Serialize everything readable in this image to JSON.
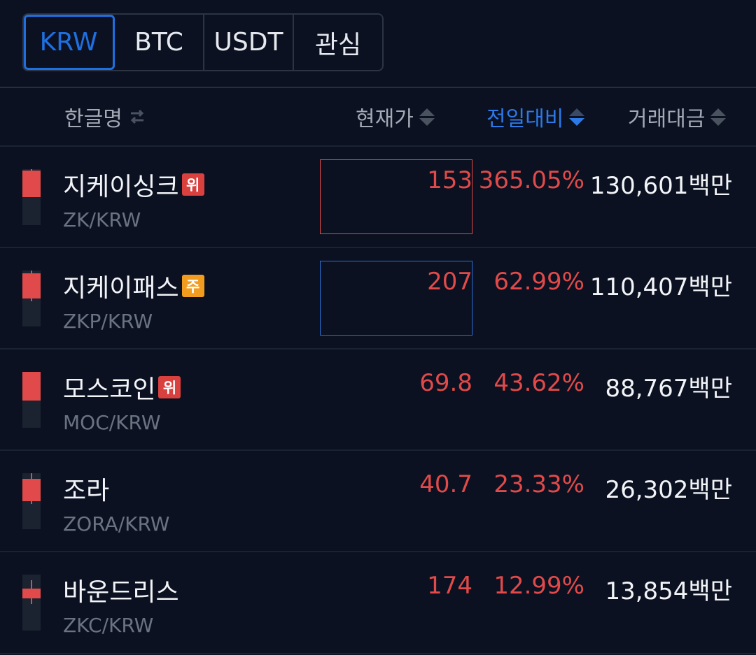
{
  "tabs": [
    "KRW",
    "BTC",
    "USDT",
    "관심"
  ],
  "header": {
    "name": "한글명",
    "price": "현재가",
    "change": "전일대비",
    "volume": "거래대금"
  },
  "colors": {
    "up": "#e04a4a",
    "accent": "#1f6fe0",
    "warning_badge": "#d9413f",
    "caution_badge": "#f29c1f",
    "flash_up": "#e04a4a",
    "flash_neutral": "#2d6fd6"
  },
  "rows": [
    {
      "name": "지케이싱크",
      "badge": "위",
      "badge_type": "warning",
      "ticker": "ZK/KRW",
      "price": "153",
      "change": "365.05%",
      "volume": "130,601백만",
      "highlight": "up"
    },
    {
      "name": "지케이패스",
      "badge": "주",
      "badge_type": "caution",
      "ticker": "ZKP/KRW",
      "price": "207",
      "change": "62.99%",
      "volume": "110,407백만",
      "highlight": "neutral"
    },
    {
      "name": "모스코인",
      "badge": "위",
      "badge_type": "warning",
      "ticker": "MOC/KRW",
      "price": "69.8",
      "change": "43.62%",
      "volume": "88,767백만",
      "highlight": "none"
    },
    {
      "name": "조라",
      "badge": "",
      "badge_type": "none",
      "ticker": "ZORA/KRW",
      "price": "40.7",
      "change": "23.33%",
      "volume": "26,302백만",
      "highlight": "none"
    },
    {
      "name": "바운드리스",
      "badge": "",
      "badge_type": "none",
      "ticker": "ZKC/KRW",
      "price": "174",
      "change": "12.99%",
      "volume": "13,854백만",
      "highlight": "none"
    }
  ]
}
